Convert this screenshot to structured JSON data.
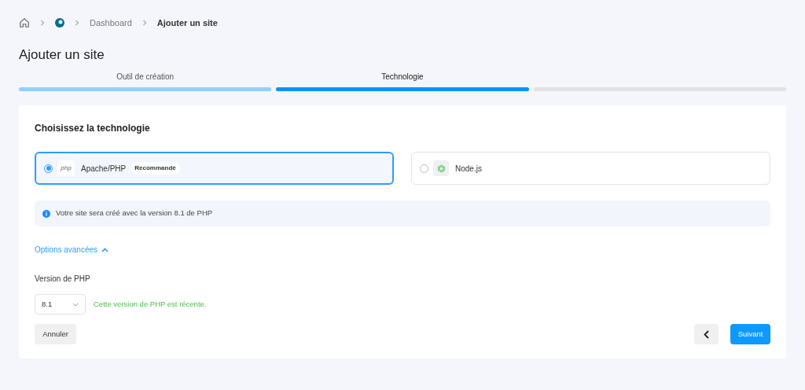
{
  "breadcrumb": [
    {
      "kind": "home"
    },
    {
      "kind": "logo"
    },
    {
      "kind": "link",
      "label": "Dashboard"
    },
    {
      "kind": "current",
      "label": "Ajouter un site"
    }
  ],
  "title": "Ajouter un site",
  "steps": [
    {
      "label": "Outil de création",
      "selected": false,
      "completed": true
    },
    {
      "label": "Technologie",
      "selected": true,
      "completed": false
    },
    {
      "selected": false,
      "completed": false
    }
  ],
  "card": {
    "heading": "Choisissez la technologie",
    "options": [
      {
        "kind": "php",
        "logo_text": "php",
        "label": "Apache/PHP",
        "badge": "Recommandé",
        "selected": true
      },
      {
        "kind": "node",
        "label": "Node.js",
        "selected": false
      }
    ],
    "info": "Votre site sera créé avec la version 8.1 de PHP",
    "advanced": {
      "label": "Options avancées",
      "expanded": true
    },
    "version": {
      "label": "Version de PHP",
      "value": "8.1",
      "note": "Cette version de PHP est récente."
    },
    "cancel": "Annuler",
    "next": "Suivant"
  }
}
